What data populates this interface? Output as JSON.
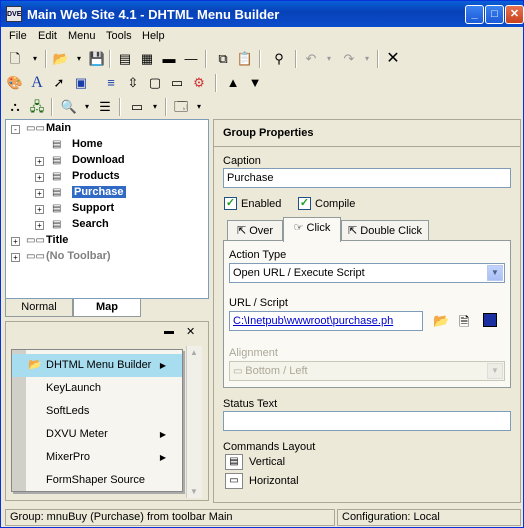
{
  "window": {
    "title": "Main Web Site 4.1 - DHTML Menu Builder",
    "app_icon": "DVE",
    "controls": [
      "minimize",
      "maximize",
      "close"
    ]
  },
  "menubar": [
    "File",
    "Edit",
    "Menu",
    "Tools",
    "Help"
  ],
  "tree": {
    "items": [
      {
        "label": "Main",
        "depth": 0,
        "expander": "-"
      },
      {
        "label": "Home",
        "depth": 2,
        "expander": ""
      },
      {
        "label": "Download",
        "depth": 2,
        "expander": "+"
      },
      {
        "label": "Products",
        "depth": 2,
        "expander": "+"
      },
      {
        "label": "Purchase",
        "depth": 2,
        "expander": "+",
        "selected": true
      },
      {
        "label": "Support",
        "depth": 2,
        "expander": "+"
      },
      {
        "label": "Search",
        "depth": 2,
        "expander": "+"
      },
      {
        "label": "Title",
        "depth": 0,
        "expander": "+"
      },
      {
        "label": "(No Toolbar)",
        "depth": 0,
        "expander": "+",
        "disabled": true
      }
    ]
  },
  "bottom_tabs": [
    "Normal",
    "Map"
  ],
  "preview_menu": {
    "items": [
      {
        "label": "DHTML Menu Builder",
        "has_submenu": true,
        "selected": true
      },
      {
        "label": "KeyLaunch",
        "has_submenu": false
      },
      {
        "label": "SoftLeds",
        "has_submenu": false
      },
      {
        "label": "DXVU Meter",
        "has_submenu": true
      },
      {
        "label": "MixerPro",
        "has_submenu": true
      },
      {
        "label": "FormShaper Source",
        "has_submenu": false
      }
    ]
  },
  "group_properties": {
    "header": "Group Properties",
    "caption_label": "Caption",
    "caption_value": "Purchase",
    "enabled_label": "Enabled",
    "compile_label": "Compile",
    "tabs": [
      "Over",
      "Click",
      "Double Click"
    ],
    "action_type_label": "Action Type",
    "action_type_value": "Open URL / Execute Script",
    "url_label": "URL / Script",
    "url_value": "C:\\Inetpub\\wwwroot\\purchase.ph",
    "alignment_label": "Alignment",
    "alignment_value": "Bottom / Left",
    "status_text_label": "Status Text",
    "status_text_value": "",
    "commands_layout_label": "Commands Layout",
    "vertical_label": "Vertical",
    "horizontal_label": "Horizontal"
  },
  "statusbar": {
    "left": "Group: mnuBuy (Purchase) from toolbar Main",
    "right": "Configuration: Local"
  }
}
